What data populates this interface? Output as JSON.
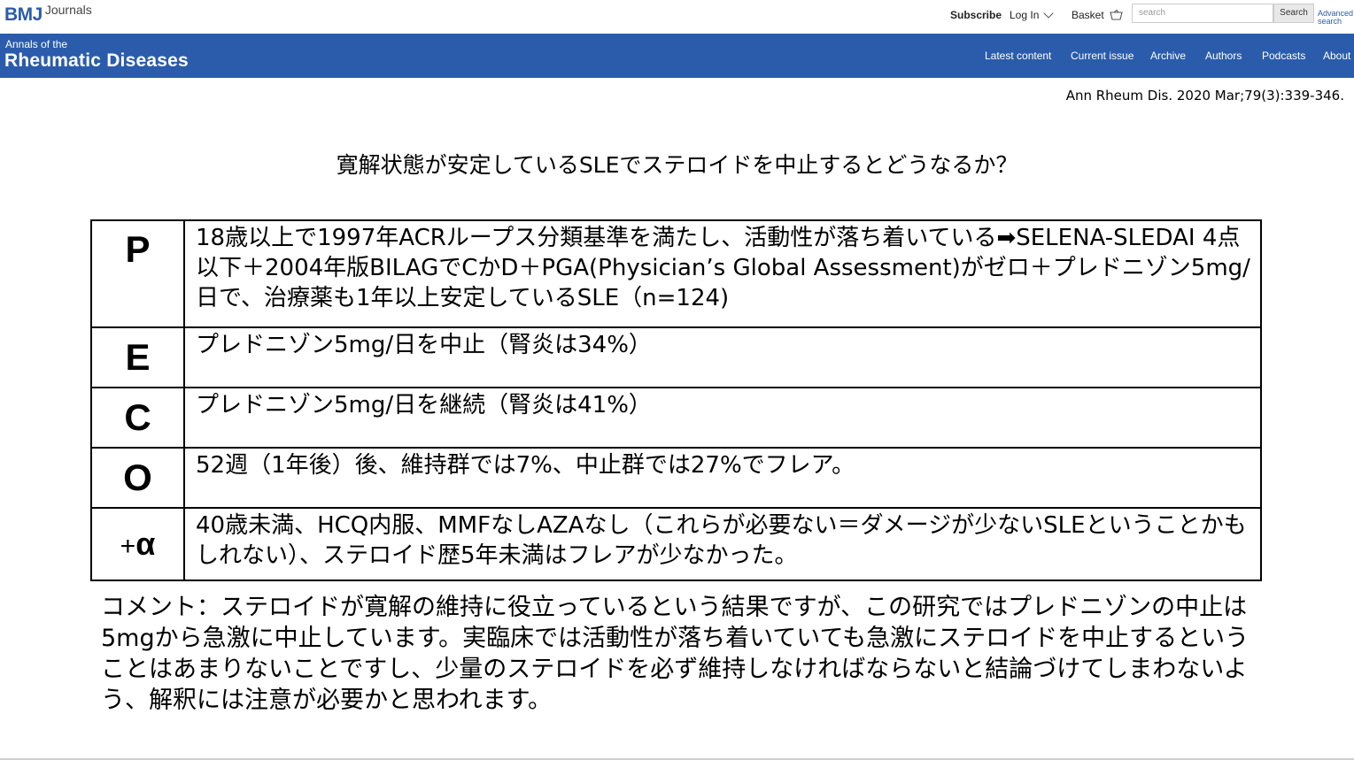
{
  "header": {
    "logo_bmj": "BMJ",
    "logo_journals": "Journals",
    "subscribe": "Subscribe",
    "login": "Log In",
    "basket": "Basket",
    "search_placeholder": "search",
    "search_button": "Search",
    "advanced_search": "Advanced search"
  },
  "journal": {
    "prefix": "Annals of the",
    "name": "Rheumatic Diseases"
  },
  "nav": {
    "items": [
      "Latest content",
      "Current issue",
      "Archive",
      "Authors",
      "Podcasts",
      "About"
    ]
  },
  "citation": "Ann Rheum Dis. 2020 Mar;79(3):339-346.",
  "question": "寛解状態が安定しているSLEでステロイドを中止するとどうなるか？",
  "peco": {
    "p_key": "P",
    "p_text": "18歳以上で1997年ACRループス分類基準を満たし、活動性が落ち着いている➡SELENA-SLEDAI 4点以下＋2004年版BILAGでCかD＋PGA(Physician’s Global Assessment)がゼロ＋プレドニゾン5mg/日で、治療薬も1年以上安定しているSLE（n=124)",
    "e_key": "E",
    "e_text": "プレドニゾン5mg/日を中止（腎炎は34%）",
    "c_key": "C",
    "c_text": "プレドニゾン5mg/日を継続（腎炎は41%）",
    "o_key": "O",
    "o_text": "52週（1年後）後、維持群では7%、中止群では27%でフレア。",
    "a_plus": "+",
    "a_key": "α",
    "a_text": "40歳未満、HCQ内服、MMFなしAZAなし（これらが必要ない＝ダメージが少ないSLEということかもしれない）、ステロイド歴5年未満はフレアが少なかった。"
  },
  "comment": "コメント：ステロイドが寛解の維持に役立っているという結果ですが、この研究ではプレドニゾンの中止は5mgから急激に中止しています。実臨床では活動性が落ち着いていても急激にステロイドを中止するということはあまりないことですし、少量のステロイドを必ず維持しなければならないと結論づけてしまわないよう、解釈には注意が必要かと思われます。"
}
